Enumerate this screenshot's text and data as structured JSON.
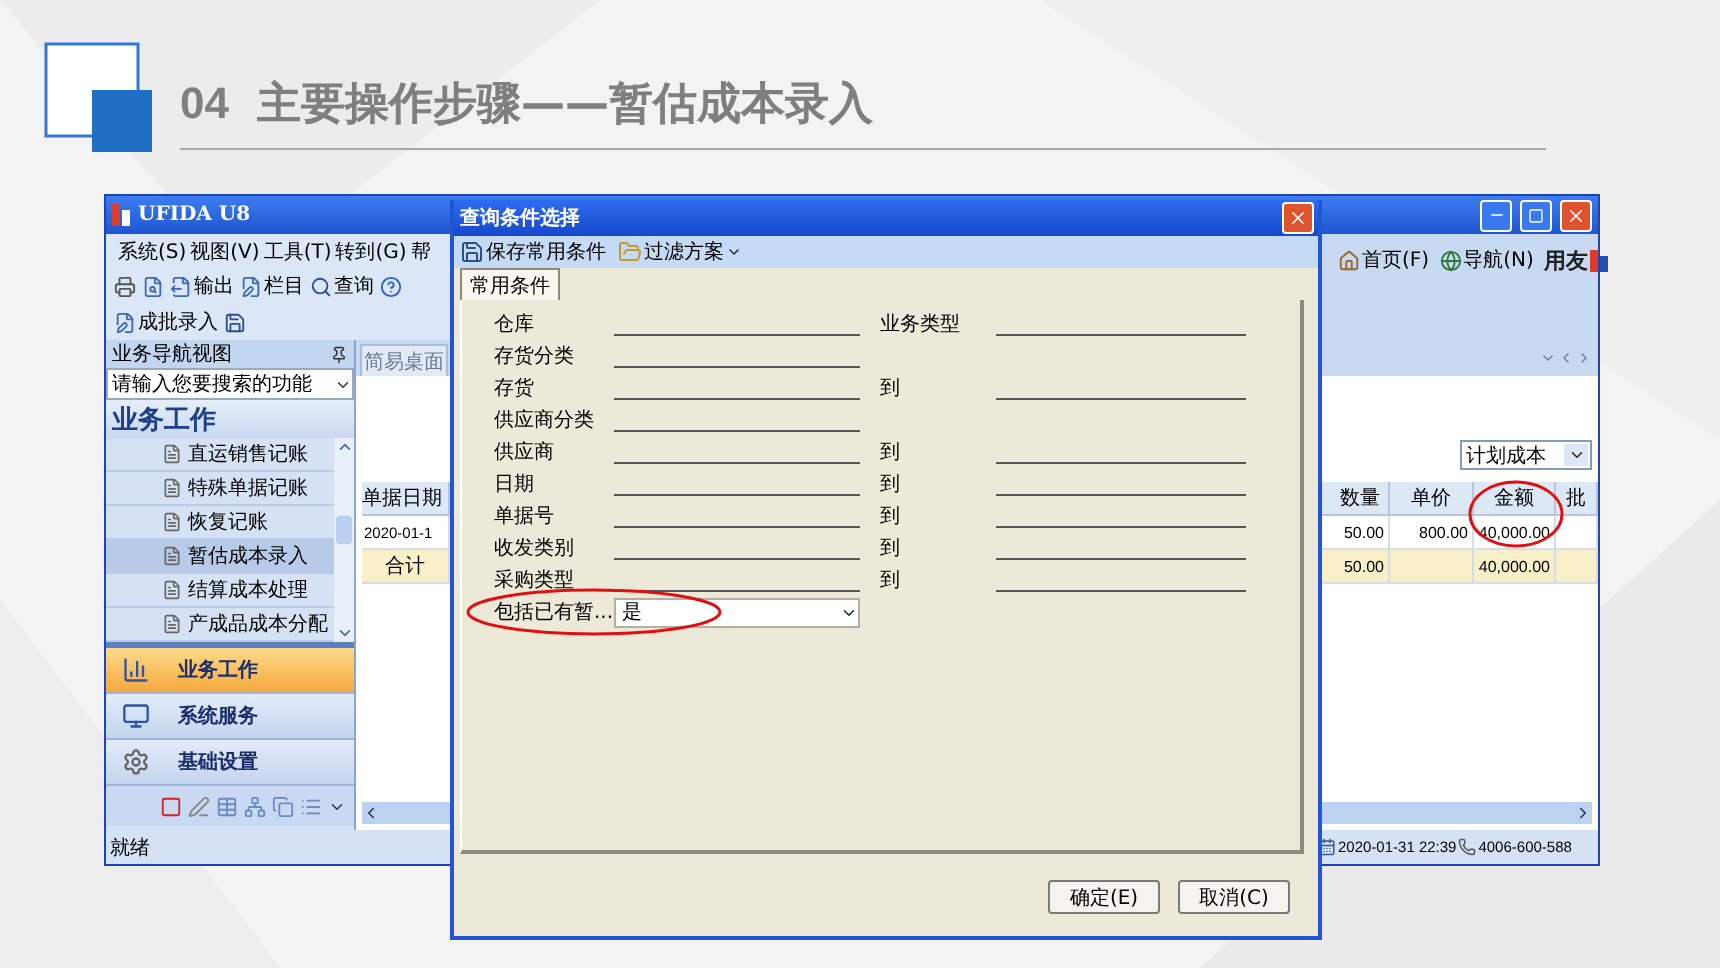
{
  "slide": {
    "number": "04",
    "title": "主要操作步骤——暂估成本录入"
  },
  "main_window": {
    "title": "UFIDA U8",
    "menu": [
      "系统(S)",
      "视图(V)",
      "工具(T)",
      "转到(G)",
      "帮"
    ],
    "toolbar": [
      {
        "kind": "print"
      },
      {
        "kind": "preview"
      },
      {
        "kind": "export",
        "label": "输出"
      },
      {
        "kind": "columns",
        "label": "栏目"
      },
      {
        "kind": "query",
        "label": "查询"
      },
      {
        "kind": "help"
      }
    ],
    "toolbar2": [
      {
        "kind": "batch",
        "label": "成批录入"
      },
      {
        "kind": "save"
      }
    ],
    "quick_links": [
      {
        "kind": "home",
        "label": "首页(F)"
      },
      {
        "kind": "nav",
        "label": "导航(N)"
      }
    ],
    "brand": "用友",
    "nav_panel": {
      "title": "业务导航视图",
      "search_placeholder": "请输入您要搜索的功能",
      "section": "业务工作",
      "items": [
        {
          "label": "直运销售记账",
          "selected": false
        },
        {
          "label": "特殊单据记账",
          "selected": false
        },
        {
          "label": "恢复记账",
          "selected": false
        },
        {
          "label": "暂估成本录入",
          "selected": true
        },
        {
          "label": "结算成本处理",
          "selected": false
        },
        {
          "label": "产成品成本分配",
          "selected": false
        }
      ],
      "modules": [
        {
          "kind": "work",
          "label": "业务工作",
          "selected": true
        },
        {
          "kind": "service",
          "label": "系统服务",
          "selected": false
        },
        {
          "kind": "settings",
          "label": "基础设置",
          "selected": false
        }
      ]
    },
    "tabs": [
      {
        "label": "简易桌面",
        "selected": false
      }
    ],
    "cost_type": "计划成本",
    "table": {
      "columns": [
        {
          "label": "单据日期",
          "circled": false
        },
        {
          "label": "数量",
          "circled": false
        },
        {
          "label": "单价",
          "circled": false
        },
        {
          "label": "金额",
          "circled": true
        },
        {
          "label": "批",
          "circled": false
        }
      ],
      "rows": [
        {
          "kind": "data",
          "cells": [
            "2020-01-1",
            "50.00",
            "800.00",
            "40,000.00",
            ""
          ]
        },
        {
          "kind": "total",
          "cells": [
            "合计",
            "50.00",
            "",
            "40,000.00",
            ""
          ]
        }
      ]
    },
    "status": "就绪",
    "status_time": "2020-01-31 22:39",
    "status_phone": "4006-600-588"
  },
  "dialog": {
    "title": "查询条件选择",
    "toolbar": [
      {
        "kind": "save",
        "label": "保存常用条件",
        "dropdown": false
      },
      {
        "kind": "folder",
        "label": "过滤方案",
        "dropdown": true
      }
    ],
    "tabs": [
      {
        "label": "常用条件",
        "selected": true
      }
    ],
    "fields": [
      {
        "label": "仓库",
        "kind": "range",
        "to": "业务类型"
      },
      {
        "label": "存货分类",
        "kind": "single"
      },
      {
        "label": "存货",
        "kind": "range",
        "to": "到"
      },
      {
        "label": "供应商分类",
        "kind": "single"
      },
      {
        "label": "供应商",
        "kind": "range",
        "to": "到"
      },
      {
        "label": "日期",
        "kind": "range",
        "to": "到"
      },
      {
        "label": "单据号",
        "kind": "range",
        "to": "到"
      },
      {
        "label": "收发类别",
        "kind": "range",
        "to": "到"
      },
      {
        "label": "采购类型",
        "kind": "range",
        "to": "到"
      },
      {
        "label": "包括已有暂...",
        "kind": "select",
        "value": "是",
        "circled": true
      }
    ],
    "buttons": [
      "确定(E)",
      "取消(C)"
    ]
  }
}
